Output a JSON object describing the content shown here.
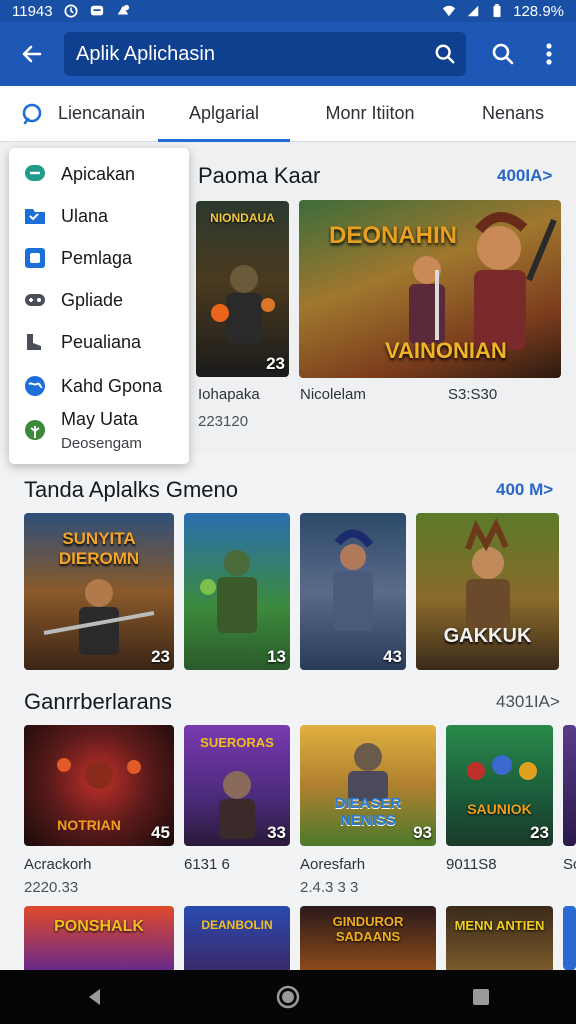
{
  "status_bar": {
    "time": "11943",
    "battery": "128.9%"
  },
  "app_bar": {
    "search_value": "Aplik Aplichasin"
  },
  "tabs": [
    "Liencanain",
    "Aplgarial",
    "Monr Itiiton",
    "Nenans"
  ],
  "dropdown": {
    "items": [
      "Apicakan",
      "Ulana",
      "Pemlaga",
      "Gpliade",
      "Peualiana",
      "Kahd Gpona",
      "May Uata"
    ],
    "last_sub": "Deosengam"
  },
  "section1": {
    "title": "Paoma Kaar",
    "more": "400IA>",
    "tiles": [
      {
        "art_title": "NIONDAUA",
        "badge": "23",
        "caption": "Iohapaka",
        "sub": "223120"
      },
      {
        "art_title": "DEONAHIN",
        "art_sub": "VAINONIAN",
        "caption": "Nicolelam",
        "price": "S3:S30"
      }
    ]
  },
  "section2": {
    "title": "Tanda Aplalks Gmeno",
    "more": "400 M>",
    "tiles": [
      {
        "art_title": "SUNYITA DIEROMN",
        "badge": "23"
      },
      {
        "badge": "13"
      },
      {
        "badge": "43"
      },
      {
        "art_title": "GAKKUK"
      }
    ]
  },
  "section3": {
    "title": "Ganrrberlarans",
    "more": "4301IA>",
    "tiles": [
      {
        "art_title": "NOTRIAN",
        "badge": "45",
        "caption": "Acrackorh",
        "sub": "2220.33"
      },
      {
        "art_title": "SUERORAS",
        "badge": "33",
        "caption": "6131 6",
        "sub": ""
      },
      {
        "art_title": "DIEASER NENISS",
        "badge": "93",
        "caption": "Aoresfarh",
        "sub": "2.4.3 3 3"
      },
      {
        "art_title": "SAUNIOK",
        "badge": "23",
        "caption": "9011S8",
        "sub": ""
      },
      {
        "caption": "Sc"
      }
    ]
  },
  "section4": {
    "tiles": [
      {
        "art_title": "PONSHALK"
      },
      {
        "art_title": "DEANBOLIN"
      },
      {
        "art_title": "GINDUROR SADAANS"
      },
      {
        "art_title": "MENN ANTIEN"
      }
    ]
  },
  "colors": {
    "appbar": "#1d58b7",
    "statusbar": "#1a4fa6",
    "accent": "#1d6fd8",
    "link": "#2a66c6"
  }
}
